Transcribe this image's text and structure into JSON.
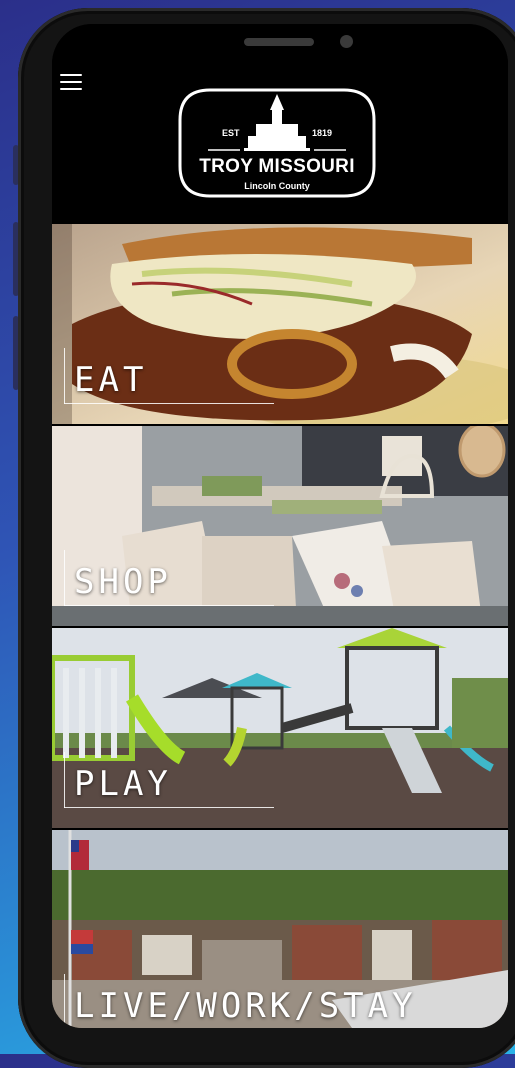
{
  "header": {
    "menu_icon": "hamburger-icon",
    "logo": {
      "est": "EST",
      "year": "1819",
      "title": "TROY MISSOURI",
      "subtitle": "Lincoln County"
    }
  },
  "tiles": [
    {
      "label": "EAT",
      "icon": "burger-photo"
    },
    {
      "label": "SHOP",
      "icon": "pillows-photo"
    },
    {
      "label": "PLAY",
      "icon": "playground-photo"
    },
    {
      "label": "LIVE/WORK/STAY",
      "icon": "town-photo"
    }
  ],
  "colors": {
    "background_top": "#2b2f8a",
    "background_bottom": "#2ab3e8",
    "phone_frame": "#141414",
    "label_text": "#ffffff"
  }
}
